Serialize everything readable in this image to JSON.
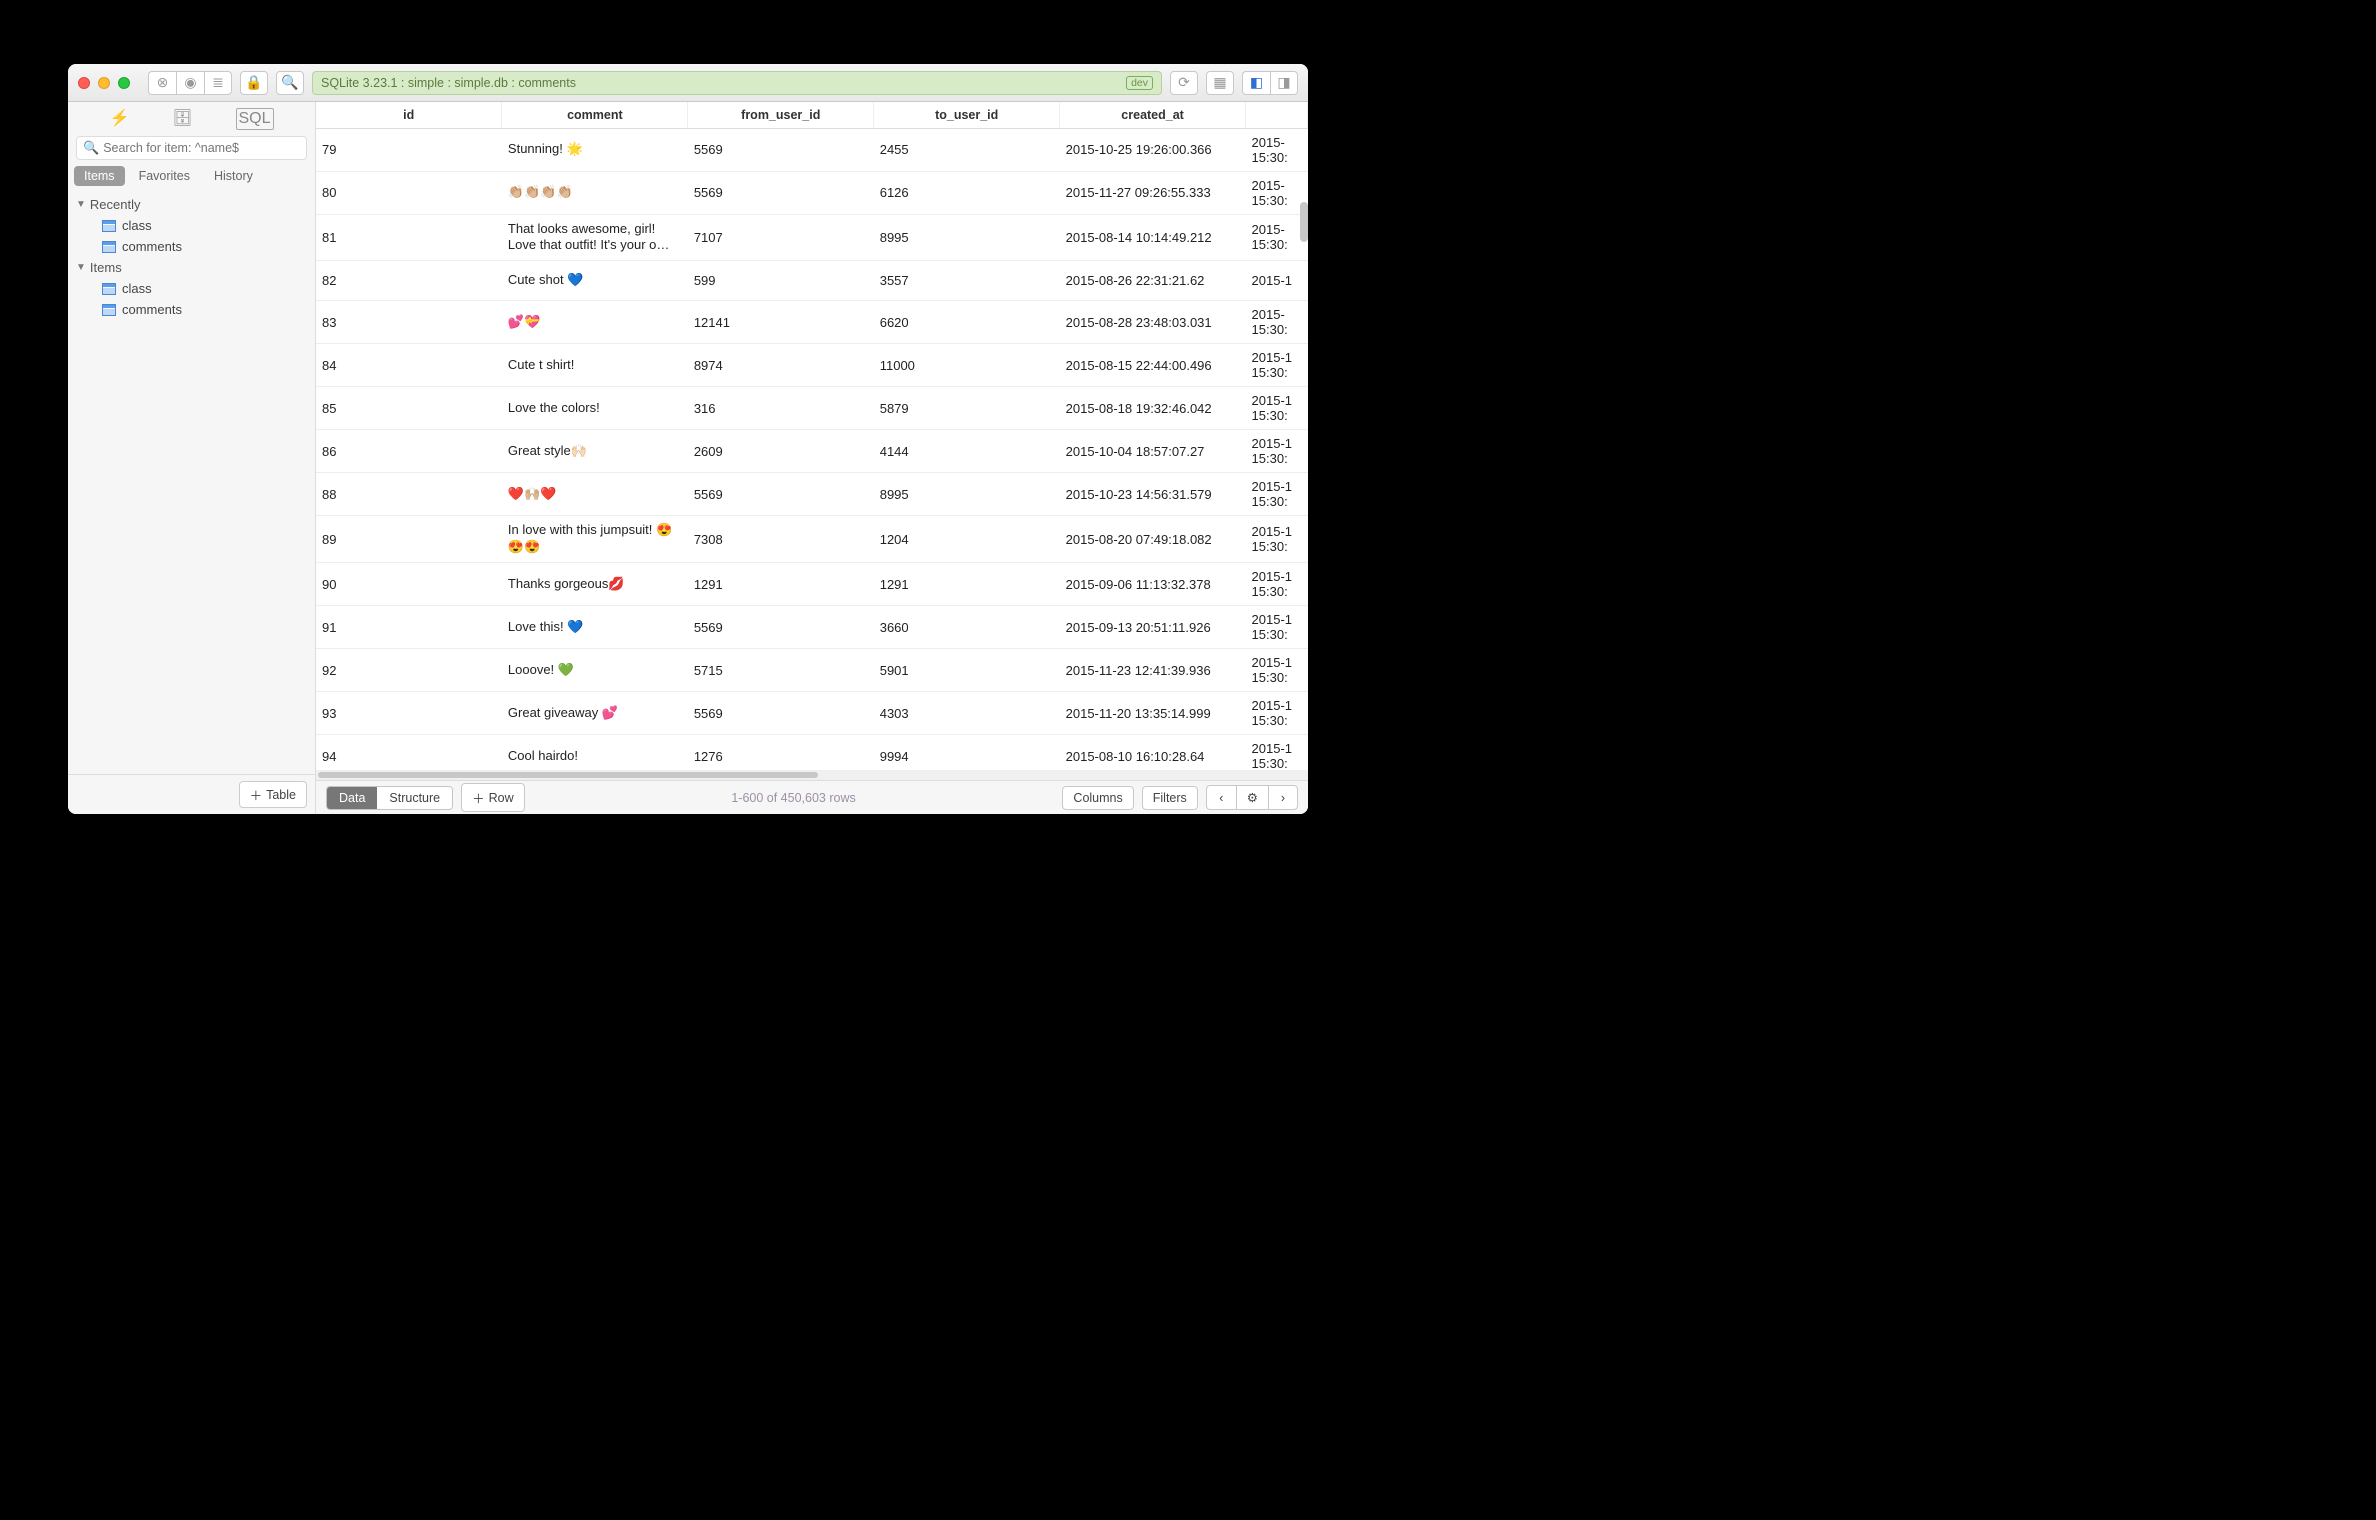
{
  "titlebar": {
    "breadcrumb": "SQLite 3.23.1 : simple : simple.db : comments",
    "dev_badge": "dev"
  },
  "sidebar": {
    "search_placeholder": "Search for item: ^name$",
    "tabs": {
      "items": "Items",
      "favorites": "Favorites",
      "history": "History"
    },
    "recently_label": "Recently",
    "items_label": "Items",
    "recently": [
      {
        "label": "class"
      },
      {
        "label": "comments"
      }
    ],
    "items": [
      {
        "label": "class"
      },
      {
        "label": "comments"
      }
    ],
    "add_table": "Table"
  },
  "columns": {
    "id": "id",
    "comment": "comment",
    "from_user_id": "from_user_id",
    "to_user_id": "to_user_id",
    "created_at": "created_at"
  },
  "rows": [
    {
      "id": "79",
      "comment": "Stunning! 🌟",
      "from": "5569",
      "to": "2455",
      "created": "2015-10-25 19:26:00.366",
      "updated": "2015-\n15:30:"
    },
    {
      "id": "80",
      "comment": "👏🏼👏🏼👏🏼👏🏼",
      "from": "5569",
      "to": "6126",
      "created": "2015-11-27 09:26:55.333",
      "updated": "2015-\n15:30:"
    },
    {
      "id": "81",
      "comment": "That looks awesome, girl! Love that outfit! It's your o…",
      "from": "7107",
      "to": "8995",
      "created": "2015-08-14 10:14:49.212",
      "updated": "2015-\n15:30:"
    },
    {
      "id": "82",
      "comment": "Cute shot 💙",
      "from": "599",
      "to": "3557",
      "created": "2015-08-26 22:31:21.62",
      "updated": "2015-1"
    },
    {
      "id": "83",
      "comment": "💕💝",
      "from": "12141",
      "to": "6620",
      "created": "2015-08-28 23:48:03.031",
      "updated": "2015-\n15:30:"
    },
    {
      "id": "84",
      "comment": "Cute t shirt!",
      "from": "8974",
      "to": "11000",
      "created": "2015-08-15 22:44:00.496",
      "updated": "2015-1\n15:30:"
    },
    {
      "id": "85",
      "comment": "Love the colors!",
      "from": "316",
      "to": "5879",
      "created": "2015-08-18 19:32:46.042",
      "updated": "2015-1\n15:30:"
    },
    {
      "id": "86",
      "comment": "Great style🙌🏻",
      "from": "2609",
      "to": "4144",
      "created": "2015-10-04 18:57:07.27",
      "updated": "2015-1\n15:30:"
    },
    {
      "id": "88",
      "comment": "❤️🙌🏼❤️",
      "from": "5569",
      "to": "8995",
      "created": "2015-10-23 14:56:31.579",
      "updated": "2015-1\n15:30:"
    },
    {
      "id": "89",
      "comment": "In love with this jumpsuit! 😍😍😍",
      "from": "7308",
      "to": "1204",
      "created": "2015-08-20 07:49:18.082",
      "updated": "2015-1\n15:30:"
    },
    {
      "id": "90",
      "comment": "Thanks gorgeous💋",
      "from": "1291",
      "to": "1291",
      "created": "2015-09-06 11:13:32.378",
      "updated": "2015-1\n15:30:"
    },
    {
      "id": "91",
      "comment": "Love this! 💙",
      "from": "5569",
      "to": "3660",
      "created": "2015-09-13 20:51:11.926",
      "updated": "2015-1\n15:30:"
    },
    {
      "id": "92",
      "comment": "Looove! 💚",
      "from": "5715",
      "to": "5901",
      "created": "2015-11-23 12:41:39.936",
      "updated": "2015-1\n15:30:"
    },
    {
      "id": "93",
      "comment": "Great giveaway 💕",
      "from": "5569",
      "to": "4303",
      "created": "2015-11-20 13:35:14.999",
      "updated": "2015-1\n15:30:"
    },
    {
      "id": "94",
      "comment": "Cool hairdo!",
      "from": "1276",
      "to": "9994",
      "created": "2015-08-10 16:10:28.64",
      "updated": "2015-1\n15:30:"
    }
  ],
  "bottom": {
    "data": "Data",
    "structure": "Structure",
    "row": "Row",
    "status": "1-600 of 450,603 rows",
    "columns_btn": "Columns",
    "filters_btn": "Filters"
  }
}
